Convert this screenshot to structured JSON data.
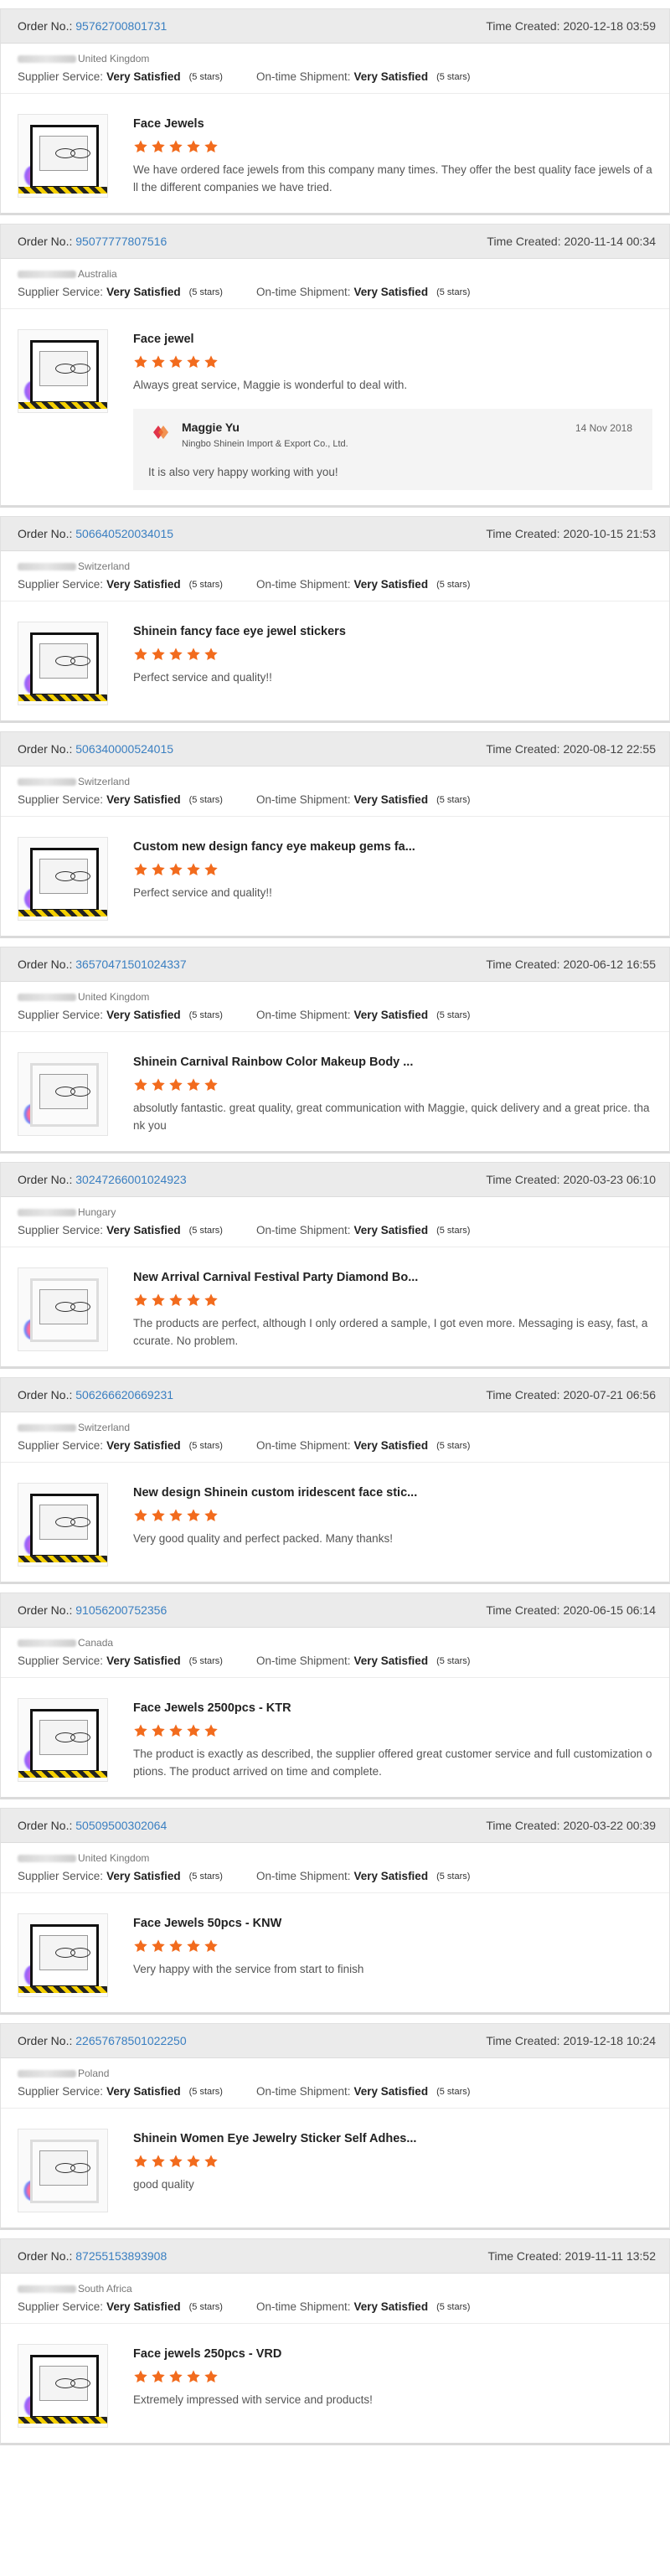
{
  "labels": {
    "order_no": "Order No.:",
    "time_created": "Time Created:",
    "supplier_service": "Supplier Service:",
    "on_time_shipment": "On-time Shipment:",
    "rating_value": "Very Satisfied",
    "stars_count": "(5 stars)"
  },
  "colors": {
    "star": "#f26b1d",
    "link": "#3a7fc1",
    "header_bg": "#ebebeb"
  },
  "reviews": [
    {
      "order_no": "95762700801731",
      "time": "2020-12-18 03:59",
      "country": "United Kingdom",
      "product": "Face Jewels",
      "rating": 5,
      "comment": "We have ordered face jewels from this company many times. They offer the best quality face jewels of all the different companies we have tried.",
      "thumb": "dark"
    },
    {
      "order_no": "95077777807516",
      "time": "2020-11-14 00:34",
      "country": "Australia",
      "product": "Face jewel",
      "rating": 5,
      "comment": "Always great service, Maggie is wonderful to deal with.",
      "thumb": "dark",
      "reply": {
        "name": "Maggie Yu",
        "company": "Ningbo Shinein Import & Export Co., Ltd.",
        "date": "14 Nov 2018",
        "text": "It is also very happy working with you!",
        "logo_text": "Shinein"
      }
    },
    {
      "order_no": "506640520034015",
      "time": "2020-10-15 21:53",
      "country": "Switzerland",
      "product": "Shinein fancy face eye jewel stickers",
      "rating": 5,
      "comment": "Perfect service and quality!!",
      "thumb": "dark"
    },
    {
      "order_no": "506340000524015",
      "time": "2020-08-12 22:55",
      "country": "Switzerland",
      "product": "Custom new design fancy eye makeup gems fa...",
      "rating": 5,
      "comment": "Perfect service and quality!!",
      "thumb": "dark"
    },
    {
      "order_no": "36570471501024337",
      "time": "2020-06-12 16:55",
      "country": "United Kingdom",
      "product": "Shinein Carnival Rainbow Color Makeup Body ...",
      "rating": 5,
      "comment": "absolutly fantastic. great quality, great communication with Maggie, quick delivery and a great price. thank you",
      "thumb": "light"
    },
    {
      "order_no": "30247266001024923",
      "time": "2020-03-23 06:10",
      "country": "Hungary",
      "product": "New Arrival Carnival Festival Party Diamond Bo...",
      "rating": 5,
      "comment": "The products are perfect, although I only ordered a sample, I got even more. Messaging is easy, fast, accurate. No problem.",
      "thumb": "light"
    },
    {
      "order_no": "506266620669231",
      "time": "2020-07-21 06:56",
      "country": "Switzerland",
      "product": "New design Shinein custom iridescent face stic...",
      "rating": 5,
      "comment": "Very good quality and perfect packed. Many thanks!",
      "thumb": "dark"
    },
    {
      "order_no": "91056200752356",
      "time": "2020-06-15 06:14",
      "country": "Canada",
      "product": "Face Jewels 2500pcs - KTR",
      "rating": 5,
      "comment": "The product is exactly as described, the supplier offered great customer service and full customization options. The product arrived on time and complete.",
      "thumb": "dark"
    },
    {
      "order_no": "50509500302064",
      "time": "2020-03-22 00:39",
      "country": "United Kingdom",
      "product": "Face Jewels 50pcs - KNW",
      "rating": 5,
      "comment": "Very happy with the service from start to finish",
      "thumb": "dark"
    },
    {
      "order_no": "22657678501022250",
      "time": "2019-12-18 10:24",
      "country": "Poland",
      "product": "Shinein Women Eye Jewelry Sticker Self Adhes...",
      "rating": 5,
      "comment": "good quality",
      "thumb": "light"
    },
    {
      "order_no": "87255153893908",
      "time": "2019-11-11 13:52",
      "country": "South Africa",
      "product": "Face jewels 250pcs - VRD",
      "rating": 5,
      "comment": "Extremely impressed with service and products!",
      "thumb": "dark"
    }
  ]
}
